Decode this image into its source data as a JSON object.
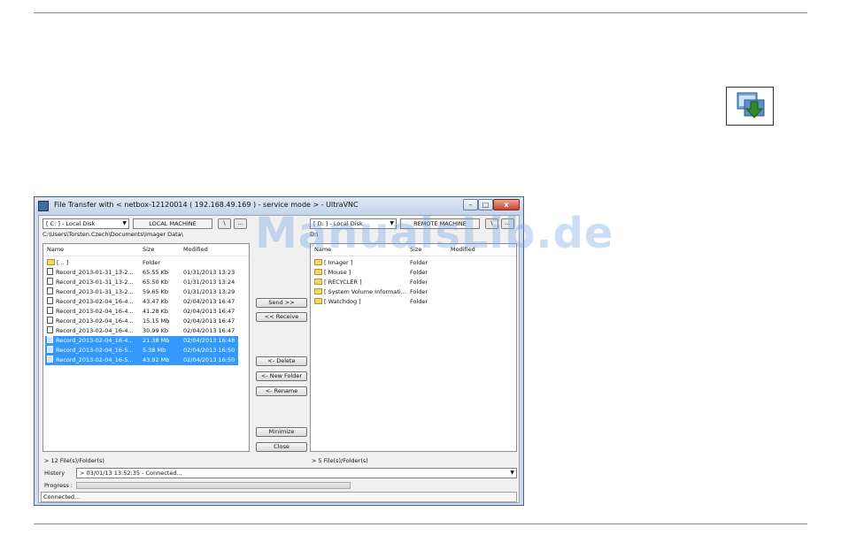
{
  "watermark": "ManualsLib.de",
  "window": {
    "title": "File Transfer with < netbox-12120014 ( 192.168.49.169 ) - service mode > - UltraVNC",
    "controls": {
      "minimize": "–",
      "maximize": "□",
      "close": "x"
    }
  },
  "local": {
    "drive": "[ C: ] - Local Disk",
    "machine_label": "LOCAL MACHINE",
    "btn_up": "\\",
    "btn_browse": "...",
    "path": "C:\\Users\\Torsten.Czech\\Documents\\Imager Data\\",
    "columns": [
      "Name",
      "Size",
      "Modified"
    ],
    "rows": [
      {
        "name": "[ .. ]",
        "size": "Folder",
        "modified": "",
        "type": "folder",
        "selected": false
      },
      {
        "name": "Record_2013-01-31_13-2...",
        "size": "65.55 Kb",
        "modified": "01/31/2013 13:23",
        "type": "file",
        "selected": false
      },
      {
        "name": "Record_2013-01-31_13-2...",
        "size": "65.50 Kb",
        "modified": "01/31/2013 13:24",
        "type": "file",
        "selected": false
      },
      {
        "name": "Record_2013-01-31_13-2...",
        "size": "59.65 Kb",
        "modified": "01/31/2013 13:29",
        "type": "file",
        "selected": false
      },
      {
        "name": "Record_2013-02-04_16-4...",
        "size": "43.47 Kb",
        "modified": "02/04/2013 16:47",
        "type": "file",
        "selected": false
      },
      {
        "name": "Record_2013-02-04_16-4...",
        "size": "41.28 Kb",
        "modified": "02/04/2013 16:47",
        "type": "file",
        "selected": false
      },
      {
        "name": "Record_2013-02-04_16-4...",
        "size": "15.15 Mb",
        "modified": "02/04/2013 16:47",
        "type": "file",
        "selected": false
      },
      {
        "name": "Record_2013-02-04_16-4...",
        "size": "30.99 Kb",
        "modified": "02/04/2013 16:47",
        "type": "file",
        "selected": false
      },
      {
        "name": "Record_2013-02-04_16-4...",
        "size": "21.38 Mb",
        "modified": "02/04/2013 16:48",
        "type": "file",
        "selected": true
      },
      {
        "name": "Record_2013-02-04_16-5...",
        "size": "5.38 Mb",
        "modified": "02/04/2013 16:50",
        "type": "file",
        "selected": true
      },
      {
        "name": "Record_2013-02-04_16-5...",
        "size": "43.92 Mb",
        "modified": "02/04/2013 16:50",
        "type": "file",
        "selected": true
      }
    ],
    "status": "> 12 File(s)/Folder(s)"
  },
  "remote": {
    "drive": "[ D: ] - Local Disk",
    "machine_label": "REMOTE MACHINE",
    "btn_up": "\\",
    "btn_browse": "...",
    "path": "D:\\",
    "columns": [
      "Name",
      "Size",
      "Modified"
    ],
    "rows": [
      {
        "name": "[ Imager ]",
        "size": "Folder"
      },
      {
        "name": "[ Mouse ]",
        "size": "Folder"
      },
      {
        "name": "[ RECYCLER ]",
        "size": "Folder"
      },
      {
        "name": "[ System Volume Informati...",
        "size": "Folder"
      },
      {
        "name": "[ Watchdog ]",
        "size": "Folder"
      }
    ],
    "status": "> 5 File(s)/Folder(s)"
  },
  "actions": {
    "send": "Send >>",
    "receive": "<< Receive",
    "delete": "<- Delete",
    "new_folder": "<- New Folder",
    "rename": "<- Rename",
    "minimize": "Minimize",
    "close": "Close"
  },
  "history": {
    "label": "History",
    "value": "> 03/01/13 13:52:35 - Connected..."
  },
  "progress": {
    "label": "Progress :"
  },
  "statusbar": "Connected..."
}
